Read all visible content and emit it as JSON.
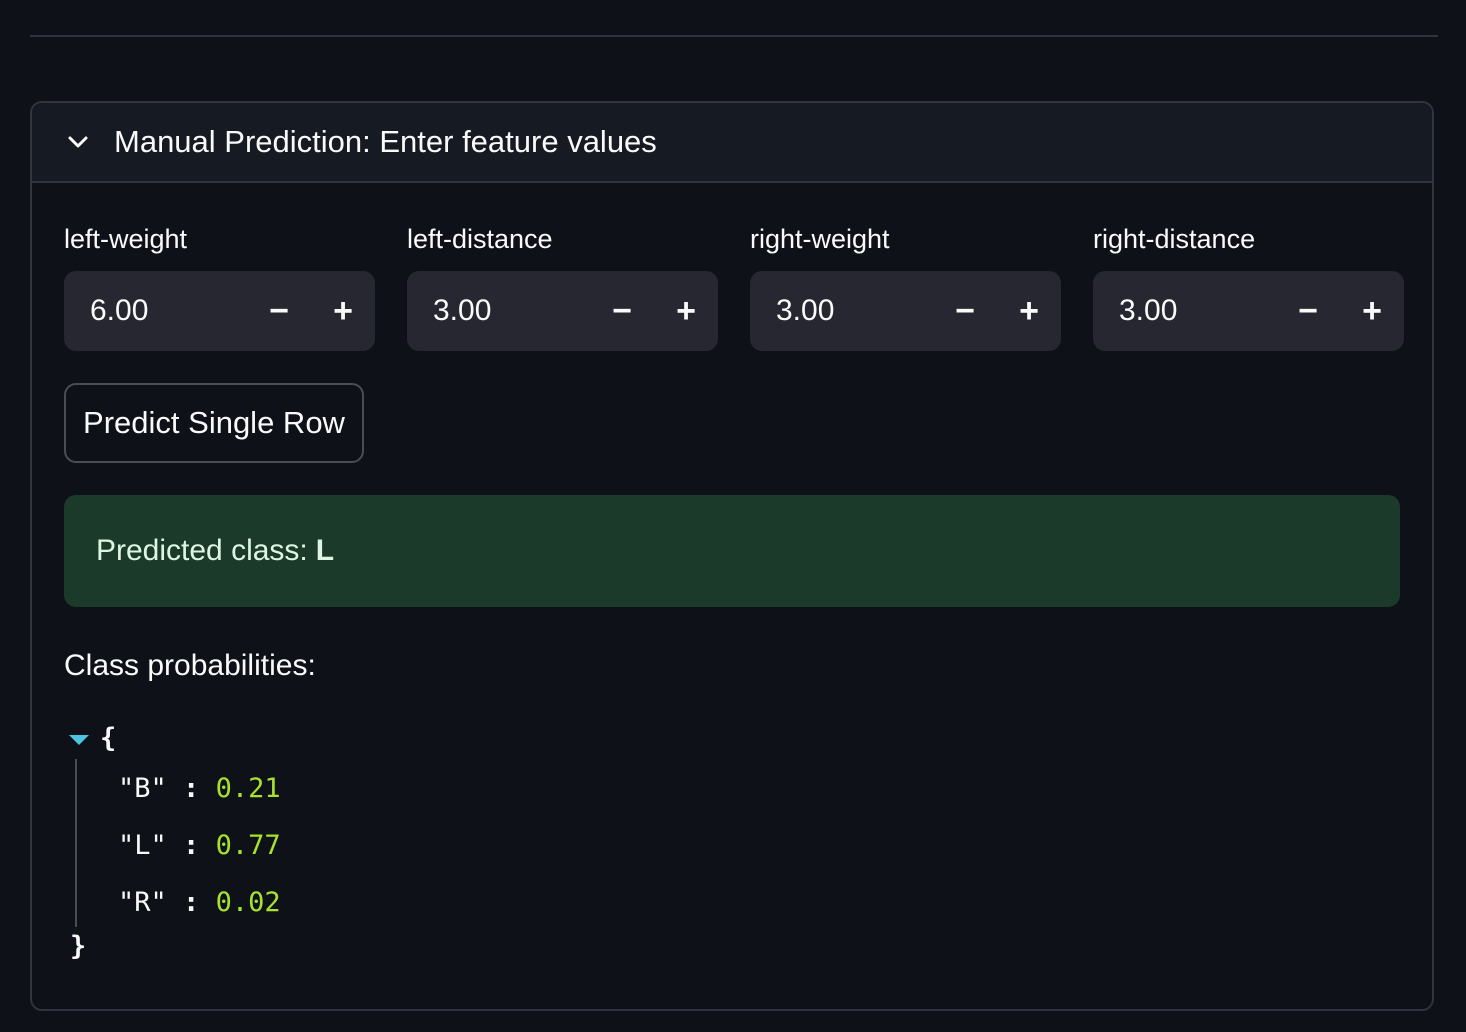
{
  "expander": {
    "title": "Manual Prediction: Enter feature values",
    "icon": "chevron-down-icon"
  },
  "fields": [
    {
      "label": "left-weight",
      "value": "6.00"
    },
    {
      "label": "left-distance",
      "value": "3.00"
    },
    {
      "label": "right-weight",
      "value": "3.00"
    },
    {
      "label": "right-distance",
      "value": "3.00"
    }
  ],
  "stepper": {
    "minus": "−",
    "plus": "+"
  },
  "predict_button": "Predict Single Row",
  "result": {
    "prefix": "Predicted class:",
    "value": "L",
    "color": "#1b3a29"
  },
  "probabilities": {
    "label": "Class probabilities:",
    "open_brace": "{",
    "close_brace": "}",
    "entries": [
      {
        "key": "\"B\"",
        "value": "0.21"
      },
      {
        "key": "\"L\"",
        "value": "0.77"
      },
      {
        "key": "\"R\"",
        "value": "0.02"
      }
    ],
    "colon": ":"
  }
}
